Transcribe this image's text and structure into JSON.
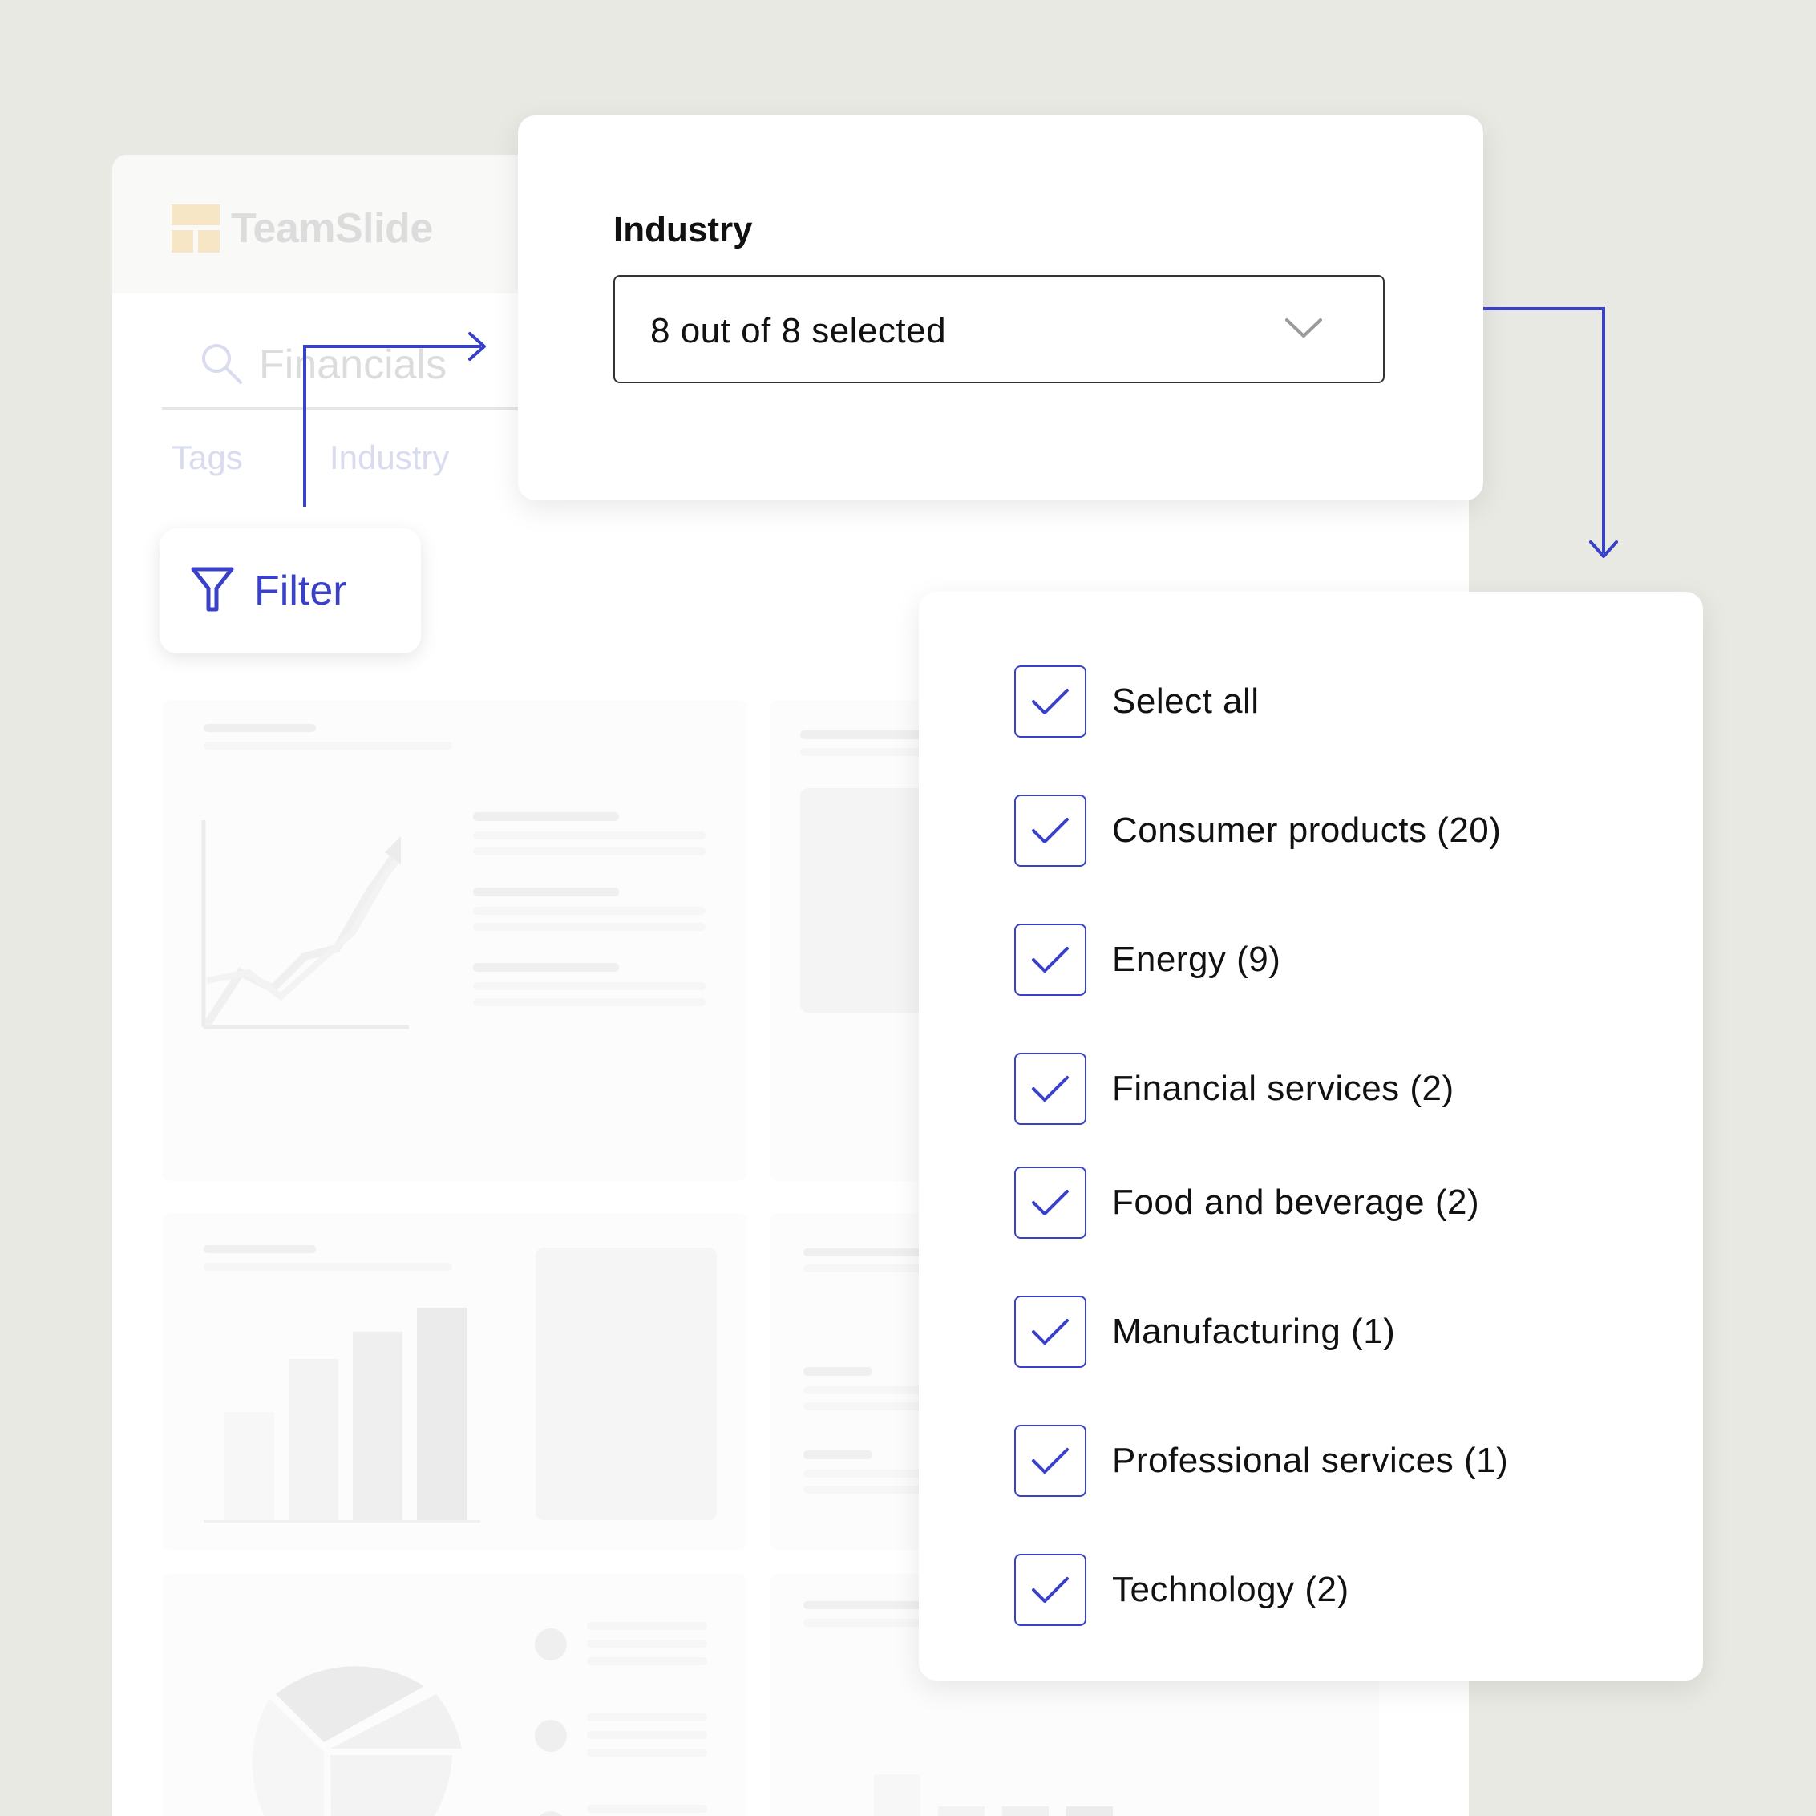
{
  "app": {
    "brand_name": "TeamSlide",
    "search_value": "Financials",
    "tabs": [
      {
        "label": "Tags"
      },
      {
        "label": "Industry"
      }
    ],
    "filter_button_label": "Filter"
  },
  "industry_filter": {
    "label": "Industry",
    "selected_text": "8 out of 8 selected"
  },
  "options": [
    {
      "label": "Select all",
      "checked": true
    },
    {
      "label": "Consumer products (20)",
      "checked": true
    },
    {
      "label": "Energy (9)",
      "checked": true
    },
    {
      "label": "Financial services (2)",
      "checked": true
    },
    {
      "label": "Food and beverage (2)",
      "checked": true
    },
    {
      "label": "Manufacturing (1)",
      "checked": true
    },
    {
      "label": "Professional services (1)",
      "checked": true
    },
    {
      "label": "Technology (2)",
      "checked": true
    }
  ],
  "colors": {
    "accent": "#3a41c9",
    "background": "#e9e9e3",
    "logo": "#f6e6c6"
  },
  "icons": [
    "search-icon",
    "filter-icon",
    "chevron-down-icon",
    "check-icon",
    "logo-mark"
  ]
}
